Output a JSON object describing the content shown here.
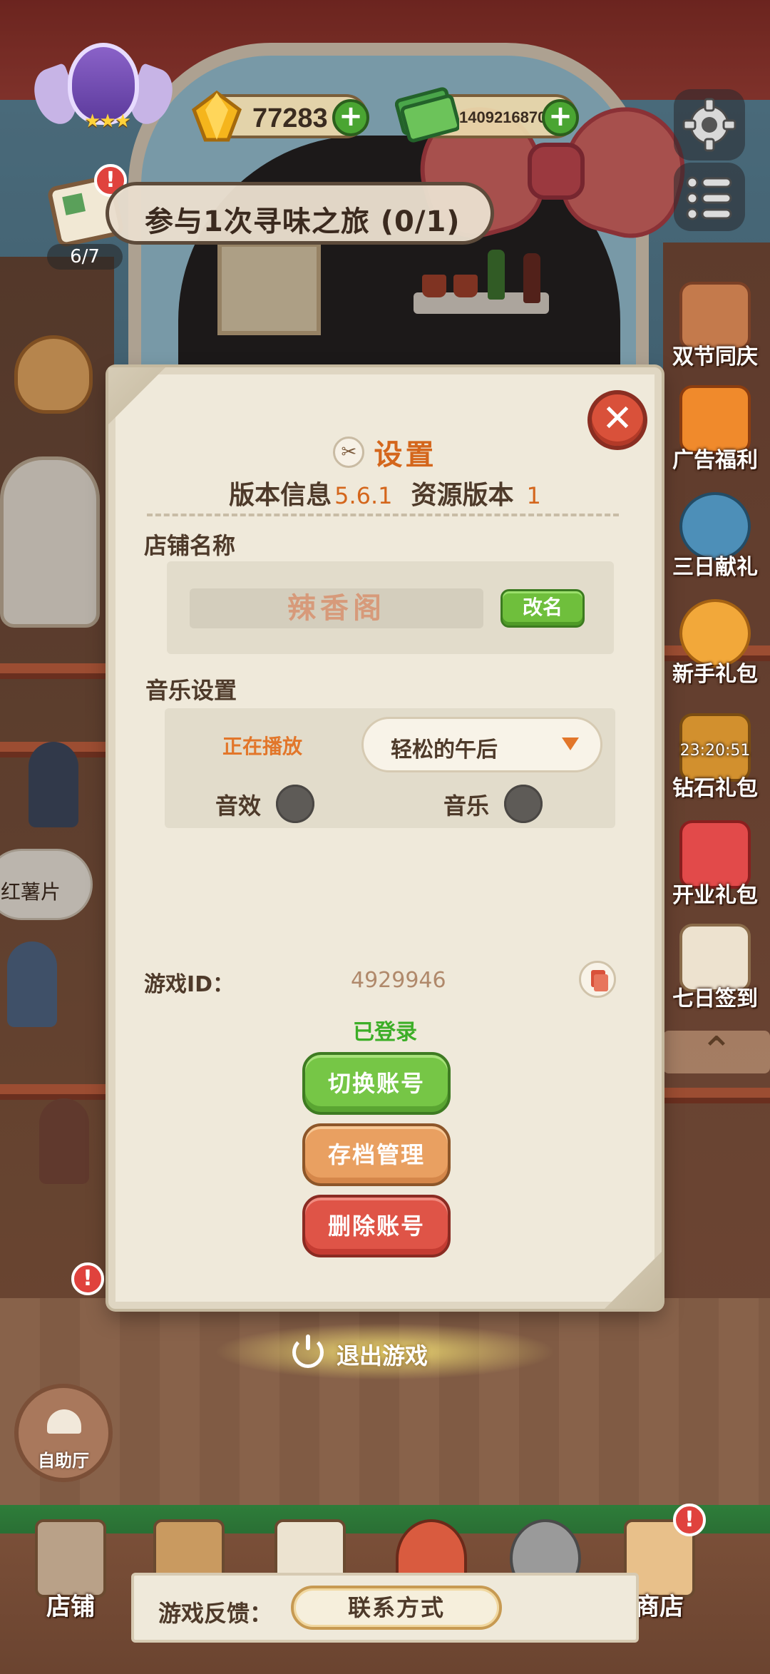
{
  "hud": {
    "gems": "77283",
    "cash": "1409216870",
    "quest_text": "参与1次寻味之旅 (0/1)",
    "quest_progress": "6/7",
    "alert_mark": "!"
  },
  "side_menu": [
    {
      "label": "双节同庆"
    },
    {
      "label": "广告福利"
    },
    {
      "label": "三日献礼"
    },
    {
      "label": "新手礼包"
    },
    {
      "label": "钻石礼包",
      "timer": "23:20:51"
    },
    {
      "label": "开业礼包"
    },
    {
      "label": "七日签到"
    }
  ],
  "scene": {
    "bubble_text": "红薯片"
  },
  "settings": {
    "title": "设置",
    "version_label": "版本信息",
    "version_value": "5.6.1",
    "resource_label": "资源版本",
    "resource_value": "1",
    "shop_name_label": "店铺名称",
    "shop_name": "辣香阁",
    "rename_label": "改名",
    "music_label": "音乐设置",
    "now_playing_label": "正在播放",
    "selected_track": "轻松的午后",
    "sfx_label": "音效",
    "music_toggle_label": "音乐",
    "game_id_label": "游戏ID：",
    "game_id": "4929946",
    "login_status": "已登录",
    "switch_account": "切换账号",
    "save_management": "存档管理",
    "delete_account": "删除账号",
    "close_symbol": "✕"
  },
  "exit_label": "退出游戏",
  "buffet_label": "自助厅",
  "bottom_nav": {
    "shop": "店铺",
    "store": "商店"
  },
  "feedback": {
    "label": "游戏反馈：",
    "contact": "联系方式"
  },
  "colors": {
    "accent_orange": "#d4661c",
    "button_green": "#76c646",
    "button_orange": "#e9a061",
    "button_red": "#df5447",
    "logged_in_green": "#3cae27"
  }
}
